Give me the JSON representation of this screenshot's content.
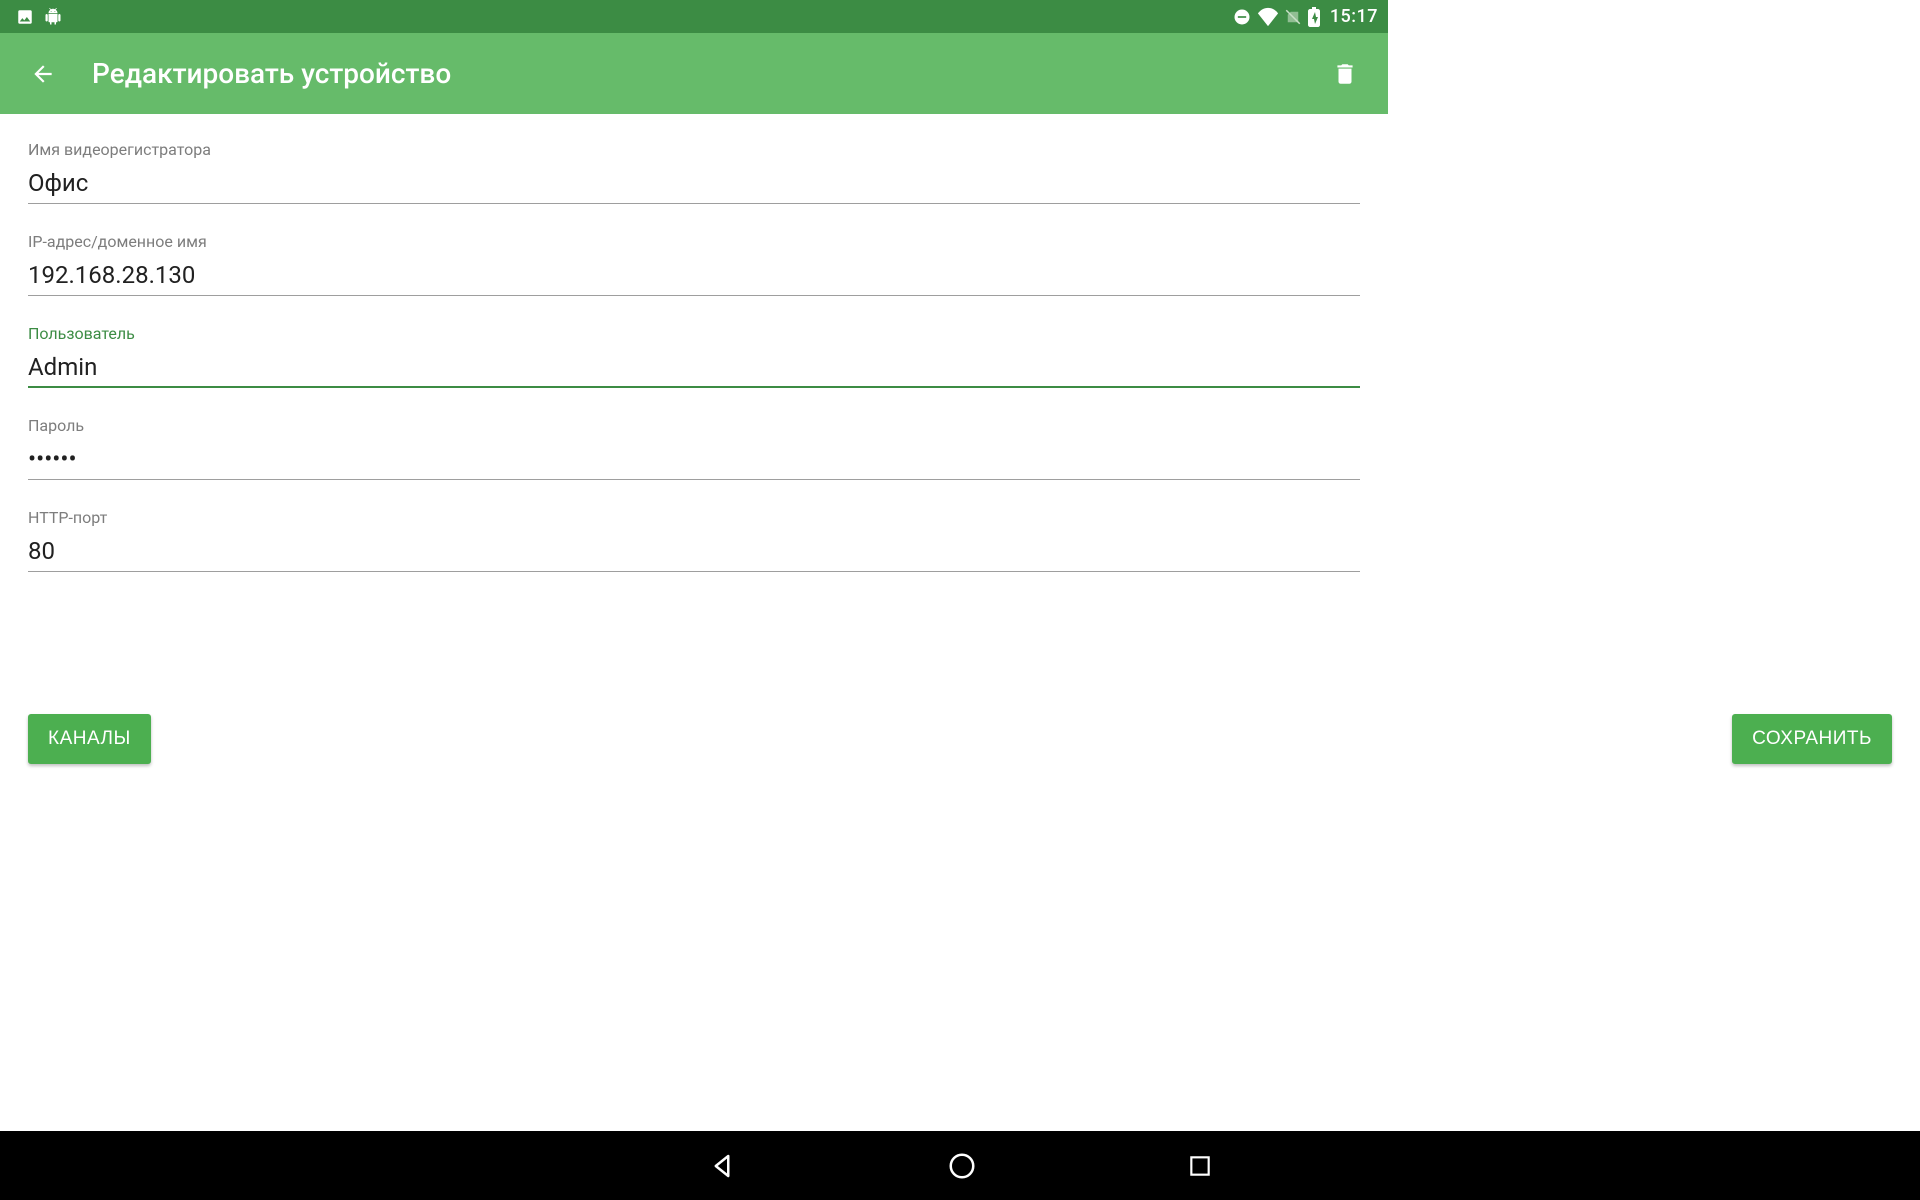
{
  "statusbar": {
    "time": "15:17"
  },
  "appbar": {
    "title": "Редактировать устройство"
  },
  "form": {
    "name_label": "Имя видеорегистратора",
    "name_value": "Офис",
    "ip_label": "IP-адрес/доменное имя",
    "ip_value": "192.168.28.130",
    "user_label": "Пользователь",
    "user_value": "Admin",
    "password_label": "Пароль",
    "password_value": "••••••",
    "port_label": "HTTP-порт",
    "port_value": "80"
  },
  "buttons": {
    "channels": "КАНАЛЫ",
    "save": "СОХРАНИТЬ"
  }
}
